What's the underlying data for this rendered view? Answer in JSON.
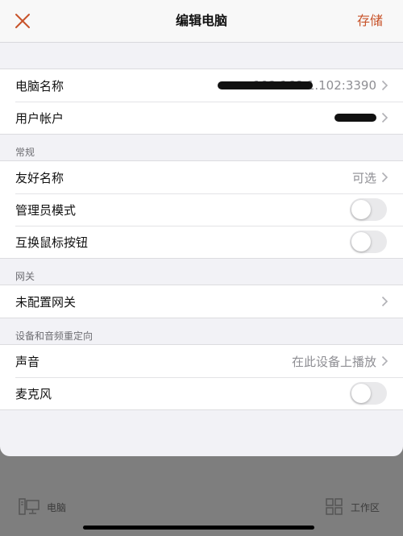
{
  "nav": {
    "title": "编辑电脑",
    "save_label": "存储"
  },
  "connection": {
    "pc_name": {
      "label": "电脑名称",
      "value": "192.168.1.102:3390"
    },
    "user_account": {
      "label": "用户帐户",
      "value": ""
    }
  },
  "general": {
    "header": "常规",
    "friendly_name": {
      "label": "友好名称",
      "value": "可选"
    },
    "admin_mode": {
      "label": "管理员模式",
      "enabled": false
    },
    "swap_mouse": {
      "label": "互换鼠标按钮",
      "enabled": false
    }
  },
  "gateway": {
    "header": "网关",
    "row": {
      "label": "未配置网关"
    }
  },
  "redirection": {
    "header": "设备和音频重定向",
    "sound": {
      "label": "声音",
      "value": "在此设备上播放"
    },
    "microphone": {
      "label": "麦克风",
      "enabled": false
    }
  },
  "tabs": {
    "pcs": {
      "label": "电脑",
      "icon": "computer-icon"
    },
    "workspaces": {
      "label": "工作区",
      "icon": "workspace-grid-icon"
    }
  },
  "colors": {
    "accent": "#c8532a",
    "overlay": "#7e7e7e",
    "background": "#f2f2f6"
  }
}
